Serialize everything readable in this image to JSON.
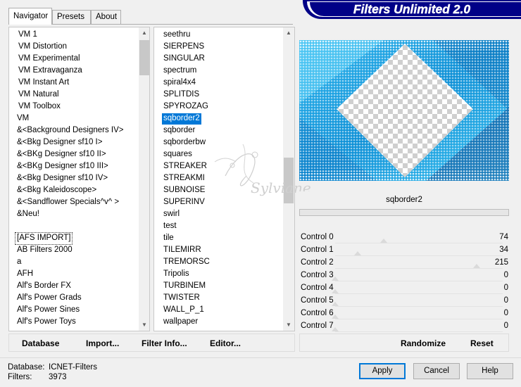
{
  "header": {
    "title": "Filters Unlimited 2.0"
  },
  "tabs": [
    {
      "label": "Navigator",
      "active": true
    },
    {
      "label": "Presets",
      "active": false
    },
    {
      "label": "About",
      "active": false
    }
  ],
  "categories": [
    "VM 1",
    "VM Distortion",
    "VM Experimental",
    "VM Extravaganza",
    "VM Instant Art",
    "VM Natural",
    "VM Toolbox",
    "VM",
    "&<Background Designers IV>",
    "&<Bkg Designer sf10 I>",
    "&<BKg Designer sf10 II>",
    "&<BKg Designer sf10 III>",
    "&<Bkg Designer sf10 IV>",
    "&<Bkg Kaleidoscope>",
    "&<Sandflower Specials^v^ >",
    "&Neu!",
    "",
    "[AFS IMPORT]",
    "AB Filters 2000",
    "a",
    "AFH",
    "Alf's Border FX",
    "Alf's Power Grads",
    "Alf's Power Sines",
    "Alf's Power Toys"
  ],
  "filters": [
    "seethru",
    "SIERPENS",
    "SINGULAR",
    "spectrum",
    "spiral4x4",
    "SPLITDIS",
    "SPYROZAG",
    "sqborder2",
    "sqborder",
    "sqborderbw",
    "squares",
    "STREAKER",
    "STREAKMI",
    "SUBNOISE",
    "SUPERINV",
    "swirl",
    "test",
    "tile",
    "TILEMIRR",
    "TREMORSC",
    "Tripolis",
    "TURBINEM",
    "TWISTER",
    "WALL_P_1",
    "wallpaper"
  ],
  "selected_filter": "sqborder2",
  "preview": {
    "filter_name": "sqborder2",
    "watermark": "Sylviane"
  },
  "controls": [
    {
      "label": "Control 0",
      "value": "74"
    },
    {
      "label": "Control 1",
      "value": "34"
    },
    {
      "label": "Control 2",
      "value": "215"
    },
    {
      "label": "Control 3",
      "value": "0"
    },
    {
      "label": "Control 4",
      "value": "0"
    },
    {
      "label": "Control 5",
      "value": "0"
    },
    {
      "label": "Control 6",
      "value": "0"
    },
    {
      "label": "Control 7",
      "value": "0"
    }
  ],
  "toolbar": {
    "database": "Database",
    "import": "Import...",
    "filter_info": "Filter Info...",
    "editor": "Editor...",
    "randomize": "Randomize",
    "reset": "Reset"
  },
  "status": {
    "database_label": "Database:",
    "database_value": "ICNET-Filters",
    "filters_label": "Filters:",
    "filters_value": "3973"
  },
  "dialog": {
    "apply": "Apply",
    "cancel": "Cancel",
    "help": "Help"
  },
  "colors": {
    "accent": "#0078d7",
    "banner": "#010187",
    "preview_blue": "#1aa8e6"
  },
  "icons": {
    "scroll_up": "▲",
    "scroll_down": "▼"
  }
}
